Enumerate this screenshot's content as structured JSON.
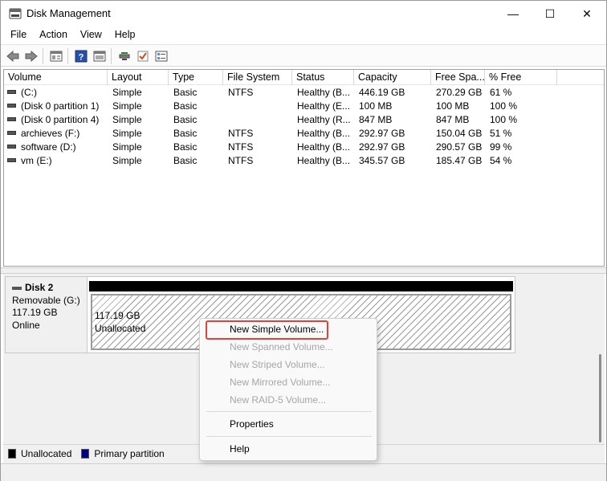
{
  "window": {
    "title": "Disk Management",
    "minimize": "—",
    "maximize": "☐",
    "close": "✕"
  },
  "menu": [
    "File",
    "Action",
    "View",
    "Help"
  ],
  "toolbar": [
    "back-icon",
    "forward-icon",
    "console-tree-icon",
    "help-icon",
    "properties-icon",
    "connect-icon",
    "check-icon",
    "list-icon"
  ],
  "volume_table": {
    "columns": [
      "Volume",
      "Layout",
      "Type",
      "File System",
      "Status",
      "Capacity",
      "Free Spa...",
      "% Free"
    ],
    "rows": [
      [
        "(C:)",
        "Simple",
        "Basic",
        "NTFS",
        "Healthy (B...",
        "446.19 GB",
        "270.29 GB",
        "61 %"
      ],
      [
        "(Disk 0 partition 1)",
        "Simple",
        "Basic",
        "",
        "Healthy (E...",
        "100 MB",
        "100 MB",
        "100 %"
      ],
      [
        "(Disk 0 partition 4)",
        "Simple",
        "Basic",
        "",
        "Healthy (R...",
        "847 MB",
        "847 MB",
        "100 %"
      ],
      [
        "archieves (F:)",
        "Simple",
        "Basic",
        "NTFS",
        "Healthy (B...",
        "292.97 GB",
        "150.04 GB",
        "51 %"
      ],
      [
        "software (D:)",
        "Simple",
        "Basic",
        "NTFS",
        "Healthy (B...",
        "292.97 GB",
        "290.57 GB",
        "99 %"
      ],
      [
        "vm (E:)",
        "Simple",
        "Basic",
        "NTFS",
        "Healthy (B...",
        "345.57 GB",
        "185.47 GB",
        "54 %"
      ]
    ]
  },
  "disk": {
    "name": "Disk 2",
    "type": "Removable (G:)",
    "size": "117.19 GB",
    "state": "Online",
    "partition_size": "117.19 GB",
    "partition_label": "Unallocated"
  },
  "context_menu": {
    "items": [
      {
        "label": "New Simple Volume...",
        "enabled": true
      },
      {
        "label": "New Spanned Volume...",
        "enabled": false
      },
      {
        "label": "New Striped Volume...",
        "enabled": false
      },
      {
        "label": "New Mirrored Volume...",
        "enabled": false
      },
      {
        "label": "New RAID-5 Volume...",
        "enabled": false
      },
      {
        "label": "Properties",
        "enabled": true
      },
      {
        "label": "Help",
        "enabled": true
      }
    ],
    "highlight_color": "#e0433a"
  },
  "legend": [
    {
      "label": "Unallocated",
      "color": "#000000"
    },
    {
      "label": "Primary partition",
      "color": "#000080"
    }
  ]
}
